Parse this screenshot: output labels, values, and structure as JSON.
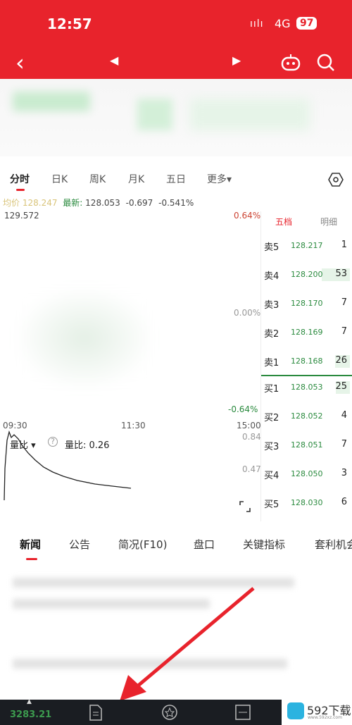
{
  "status": {
    "time": "12:57",
    "signal": "ıılı",
    "network": "4G",
    "battery": "97"
  },
  "nav": {
    "back": "‹",
    "prev": "◀",
    "next": "▶"
  },
  "tabs": [
    "分时",
    "日K",
    "周K",
    "月K",
    "五日",
    "更多▾"
  ],
  "info": {
    "avg_label": "均价",
    "avg": "128.247",
    "latest_label": "最新:",
    "latest": "128.053",
    "change": "-0.697",
    "pct": "-0.541%"
  },
  "chart": {
    "high": "129.572",
    "top_pct": "0.64%",
    "mid_pct": "0.00%",
    "bottom_pct": "-0.64%",
    "times": [
      "09:30",
      "11:30",
      "15:00"
    ],
    "vol_label": "量比 ▾",
    "vol_value_label": "量比: 0.26",
    "vol_top": "0.84",
    "vol_mid": "0.47"
  },
  "orderbook": {
    "tabs": [
      "五档",
      "明细"
    ],
    "rows": [
      {
        "label": "卖5",
        "price": "128.217",
        "vol": "1"
      },
      {
        "label": "卖4",
        "price": "128.200",
        "vol": "53"
      },
      {
        "label": "卖3",
        "price": "128.170",
        "vol": "7"
      },
      {
        "label": "卖2",
        "price": "128.169",
        "vol": "7"
      },
      {
        "label": "卖1",
        "price": "128.168",
        "vol": "26"
      },
      {
        "label": "买1",
        "price": "128.053",
        "vol": "25"
      },
      {
        "label": "买2",
        "price": "128.052",
        "vol": "4"
      },
      {
        "label": "买3",
        "price": "128.051",
        "vol": "7"
      },
      {
        "label": "买4",
        "price": "128.050",
        "vol": "3"
      },
      {
        "label": "买5",
        "price": "128.030",
        "vol": "6"
      }
    ]
  },
  "bottom_tabs": [
    "新闻",
    "公告",
    "简况(F10)",
    "盘口",
    "关键指标",
    "套利机会"
  ],
  "footer": {
    "index": "3283.21",
    "watermark": "592下载",
    "watermark_url": "www.592xz.com"
  },
  "colors": {
    "red": "#e8232c",
    "green": "#2a8a3e"
  }
}
